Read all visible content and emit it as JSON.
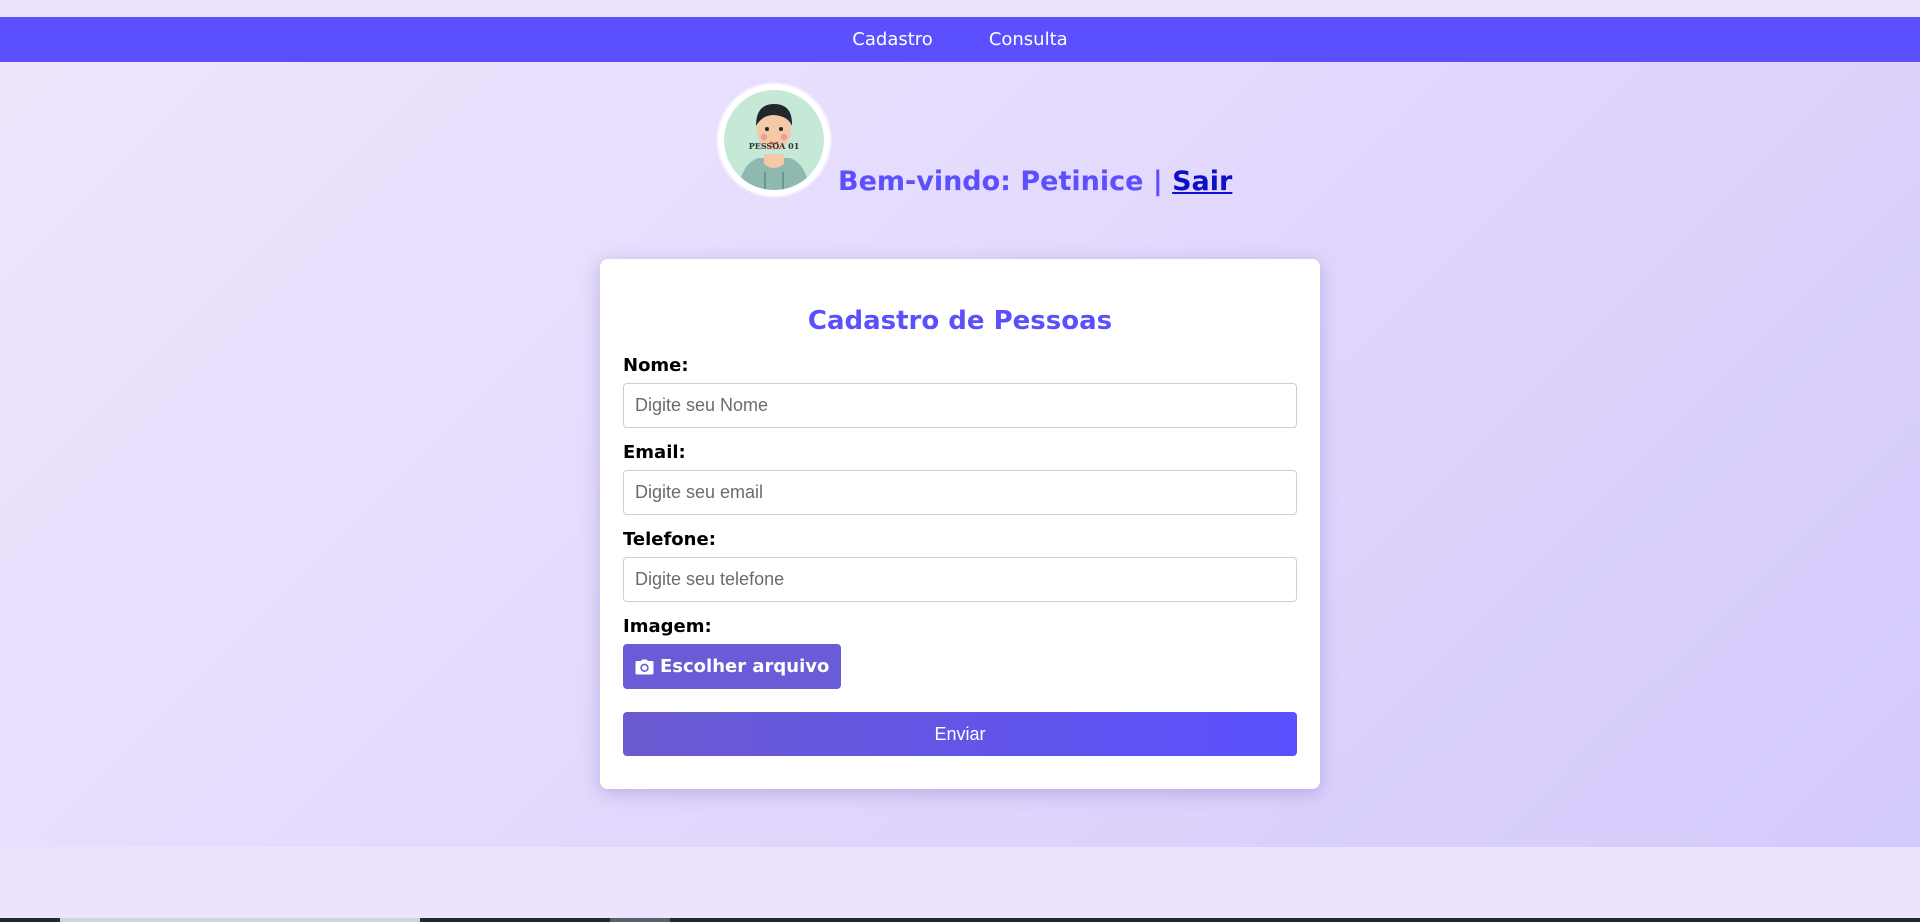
{
  "nav": {
    "items": [
      {
        "label": "Cadastro"
      },
      {
        "label": "Consulta"
      }
    ]
  },
  "header": {
    "avatar_text": "PESSOA 01",
    "welcome_label": "Bem-vindo: Petinice |",
    "logout_label": "Sair"
  },
  "form": {
    "title": "Cadastro de Pessoas",
    "fields": [
      {
        "label": "Nome:",
        "placeholder": "Digite seu Nome",
        "value": ""
      },
      {
        "label": "Email:",
        "placeholder": "Digite seu email",
        "value": ""
      },
      {
        "label": "Telefone:",
        "placeholder": "Digite seu telefone",
        "value": ""
      }
    ],
    "image_label": "Imagem:",
    "file_button_label": "Escolher arquivo",
    "file_button_icon": "camera-icon",
    "submit_label": "Enviar"
  },
  "colors": {
    "accent": "#5b4ffe",
    "logout_link": "#0d10c8",
    "file_button": "#6a5bd6"
  }
}
